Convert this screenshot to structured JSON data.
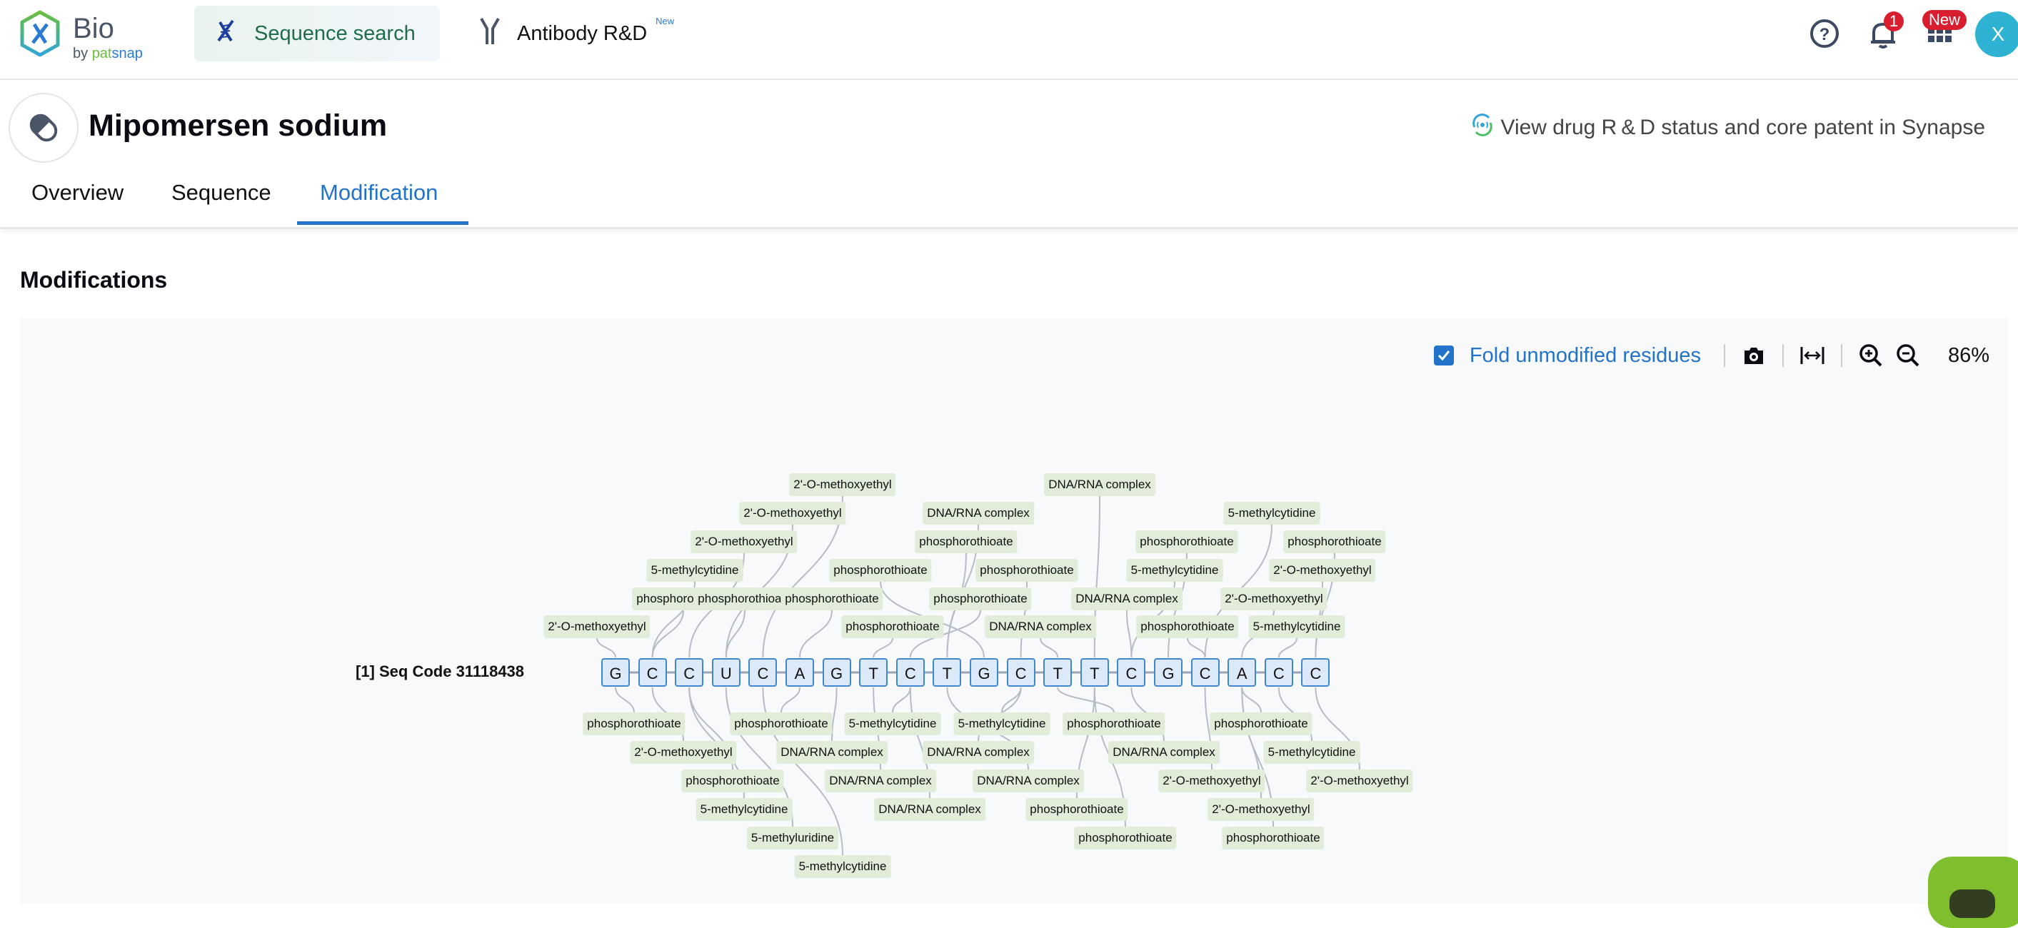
{
  "app": {
    "logo_title": "Bio",
    "logo_by": "by",
    "logo_pat": "pat",
    "logo_snap": "snap"
  },
  "nav": {
    "items": [
      {
        "label": "Sequence search",
        "icon": "dna-icon",
        "active": true
      },
      {
        "label": "Antibody R&D",
        "icon": "antibody-icon",
        "badge": "New"
      }
    ]
  },
  "topbar_right": {
    "notification_count": "1",
    "apps_badge": "New",
    "avatar_initial": "X"
  },
  "drug": {
    "title": "Mipomersen sodium",
    "synapse_link": "View drug R & D status and core patent in Synapse"
  },
  "tabs": [
    {
      "label": "Overview",
      "active": false
    },
    {
      "label": "Sequence",
      "active": false
    },
    {
      "label": "Modification",
      "active": true
    }
  ],
  "section_title": "Modifications",
  "toolbar": {
    "fold_checked": true,
    "fold_label": "Fold unmodified residues",
    "zoom_level": "86%"
  },
  "colors": {
    "accent": "#2273c9",
    "residue_border": "#3f88cf",
    "residue_fill": "#dbe9f8",
    "mod_fill": "#e1ecd9",
    "badge": "#d81e2f",
    "avatar": "#2eb2d3"
  },
  "sequence": {
    "label": "[1] Seq Code 31118438",
    "residues": [
      "G",
      "C",
      "C",
      "U",
      "C",
      "A",
      "G",
      "T",
      "C",
      "T",
      "G",
      "C",
      "T",
      "T",
      "C",
      "G",
      "C",
      "A",
      "C",
      "C"
    ]
  },
  "modifications_above": [
    {
      "label": "2'-O-methoxyethyl",
      "residue": 0
    },
    {
      "label": "phosphorothioate",
      "residue": 1
    },
    {
      "label": "5-methylcytidine",
      "residue": 1
    },
    {
      "label": "2'-O-methoxyethyl",
      "residue": 2
    },
    {
      "label": "2'-O-methoxyethyl",
      "residue": 3
    },
    {
      "label": "2'-O-methoxyethyl",
      "residue": 4
    },
    {
      "label": "phosphorothioate",
      "residue": 3
    },
    {
      "label": "phosphorothioate",
      "residue": 5
    },
    {
      "label": "phosphorothioate",
      "residue": 7
    },
    {
      "label": "phosphorothioate",
      "residue": 8
    },
    {
      "label": "phosphorothioate",
      "residue": 10
    },
    {
      "label": "phosphorothioate",
      "residue": 9
    },
    {
      "label": "DNA/RNA complex",
      "residue": 9
    },
    {
      "label": "phosphorothioate",
      "residue": 11
    },
    {
      "label": "DNA/RNA complex",
      "residue": 12
    },
    {
      "label": "DNA/RNA complex",
      "residue": 13
    },
    {
      "label": "DNA/RNA complex",
      "residue": 14
    },
    {
      "label": "phosphorothioate",
      "residue": 15
    },
    {
      "label": "5-methylcytidine",
      "residue": 14
    },
    {
      "label": "phosphorothioate",
      "residue": 16
    },
    {
      "label": "5-methylcytidine",
      "residue": 18
    },
    {
      "label": "2'-O-methoxyethyl",
      "residue": 17
    },
    {
      "label": "2'-O-methoxyethyl",
      "residue": 19
    },
    {
      "label": "phosphorothioate",
      "residue": 19
    },
    {
      "label": "5-methylcytidine",
      "residue": 16
    }
  ],
  "modifications_below": [
    {
      "label": "phosphorothioate",
      "residue": 0
    },
    {
      "label": "2'-O-methoxyethyl",
      "residue": 1
    },
    {
      "label": "phosphorothioate",
      "residue": 2
    },
    {
      "label": "5-methylcytidine",
      "residue": 2
    },
    {
      "label": "5-methyluridine",
      "residue": 3
    },
    {
      "label": "5-methylcytidine",
      "residue": 4
    },
    {
      "label": "phosphorothioate",
      "residue": 5
    },
    {
      "label": "DNA/RNA complex",
      "residue": 6
    },
    {
      "label": "DNA/RNA complex",
      "residue": 7
    },
    {
      "label": "DNA/RNA complex",
      "residue": 8
    },
    {
      "label": "5-methylcytidine",
      "residue": 8
    },
    {
      "label": "DNA/RNA complex",
      "residue": 9
    },
    {
      "label": "5-methylcytidine",
      "residue": 11
    },
    {
      "label": "DNA/RNA complex",
      "residue": 11
    },
    {
      "label": "phosphorothioate",
      "residue": 12
    },
    {
      "label": "phosphorothioate",
      "residue": 13
    },
    {
      "label": "phosphorothioate",
      "residue": 13
    },
    {
      "label": "DNA/RNA complex",
      "residue": 14
    },
    {
      "label": "phosphorothioate",
      "residue": 17
    },
    {
      "label": "2'-O-methoxyethyl",
      "residue": 16
    },
    {
      "label": "2'-O-methoxyethyl",
      "residue": 17
    },
    {
      "label": "phosphorothioate",
      "residue": 17
    },
    {
      "label": "5-methylcytidine",
      "residue": 18
    },
    {
      "label": "2'-O-methoxyethyl",
      "residue": 19
    }
  ]
}
